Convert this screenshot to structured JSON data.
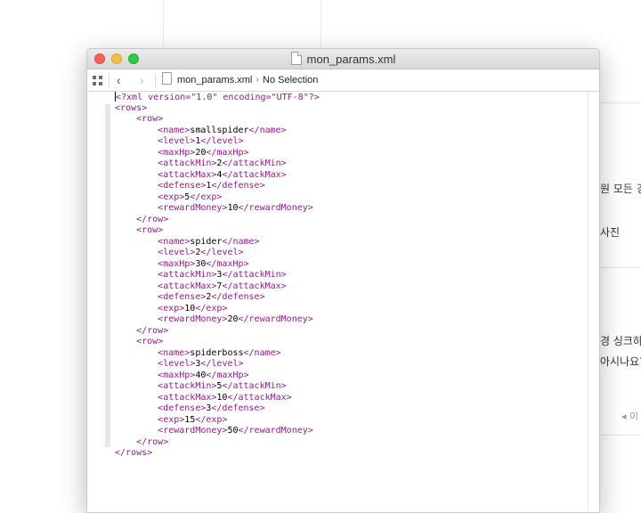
{
  "window": {
    "title": "mon_params.xml",
    "jumpbar": {
      "file": "mon_params.xml",
      "selection": "No Selection"
    }
  },
  "background": {
    "text1": "원 모든 경",
    "text2": "사진",
    "text3": "경 싱크하기",
    "text4": "아시나요? (",
    "text5": "◂ 이"
  },
  "code_lines": [
    {
      "indent": 0,
      "text": "<?xml version=\"1.0\" encoding=\"UTF-8\"?>",
      "kind": "tag"
    },
    {
      "indent": 0,
      "text": "<rows>",
      "kind": "tag"
    },
    {
      "indent": 1,
      "text": "<row>",
      "kind": "tag"
    },
    {
      "indent": 2,
      "open": "<name>",
      "value": "smallspider",
      "close": "</name>"
    },
    {
      "indent": 2,
      "open": "<level>",
      "value": "1",
      "close": "</level>"
    },
    {
      "indent": 2,
      "open": "<maxHp>",
      "value": "20",
      "close": "</maxHp>"
    },
    {
      "indent": 2,
      "open": "<attackMin>",
      "value": "2",
      "close": "</attackMin>"
    },
    {
      "indent": 2,
      "open": "<attackMax>",
      "value": "4",
      "close": "</attackMax>"
    },
    {
      "indent": 2,
      "open": "<defense>",
      "value": "1",
      "close": "</defense>"
    },
    {
      "indent": 2,
      "open": "<exp>",
      "value": "5",
      "close": "</exp>"
    },
    {
      "indent": 2,
      "open": "<rewardMoney>",
      "value": "10",
      "close": "</rewardMoney>"
    },
    {
      "indent": 1,
      "text": "</row>",
      "kind": "tag"
    },
    {
      "indent": 1,
      "text": "<row>",
      "kind": "tag"
    },
    {
      "indent": 2,
      "open": "<name>",
      "value": "spider",
      "close": "</name>"
    },
    {
      "indent": 2,
      "open": "<level>",
      "value": "2",
      "close": "</level>"
    },
    {
      "indent": 2,
      "open": "<maxHp>",
      "value": "30",
      "close": "</maxHp>"
    },
    {
      "indent": 2,
      "open": "<attackMin>",
      "value": "3",
      "close": "</attackMin>"
    },
    {
      "indent": 2,
      "open": "<attackMax>",
      "value": "7",
      "close": "</attackMax>"
    },
    {
      "indent": 2,
      "open": "<defense>",
      "value": "2",
      "close": "</defense>"
    },
    {
      "indent": 2,
      "open": "<exp>",
      "value": "10",
      "close": "</exp>"
    },
    {
      "indent": 2,
      "open": "<rewardMoney>",
      "value": "20",
      "close": "</rewardMoney>"
    },
    {
      "indent": 1,
      "text": "</row>",
      "kind": "tag"
    },
    {
      "indent": 1,
      "text": "<row>",
      "kind": "tag"
    },
    {
      "indent": 2,
      "open": "<name>",
      "value": "spiderboss",
      "close": "</name>"
    },
    {
      "indent": 2,
      "open": "<level>",
      "value": "3",
      "close": "</level>"
    },
    {
      "indent": 2,
      "open": "<maxHp>",
      "value": "40",
      "close": "</maxHp>"
    },
    {
      "indent": 2,
      "open": "<attackMin>",
      "value": "5",
      "close": "</attackMin>"
    },
    {
      "indent": 2,
      "open": "<attackMax>",
      "value": "10",
      "close": "</attackMax>"
    },
    {
      "indent": 2,
      "open": "<defense>",
      "value": "3",
      "close": "</defense>"
    },
    {
      "indent": 2,
      "open": "<exp>",
      "value": "15",
      "close": "</exp>"
    },
    {
      "indent": 2,
      "open": "<rewardMoney>",
      "value": "50",
      "close": "</rewardMoney>"
    },
    {
      "indent": 1,
      "text": "</row>",
      "kind": "tag"
    },
    {
      "indent": 0,
      "text": "</rows>",
      "kind": "tag"
    }
  ]
}
